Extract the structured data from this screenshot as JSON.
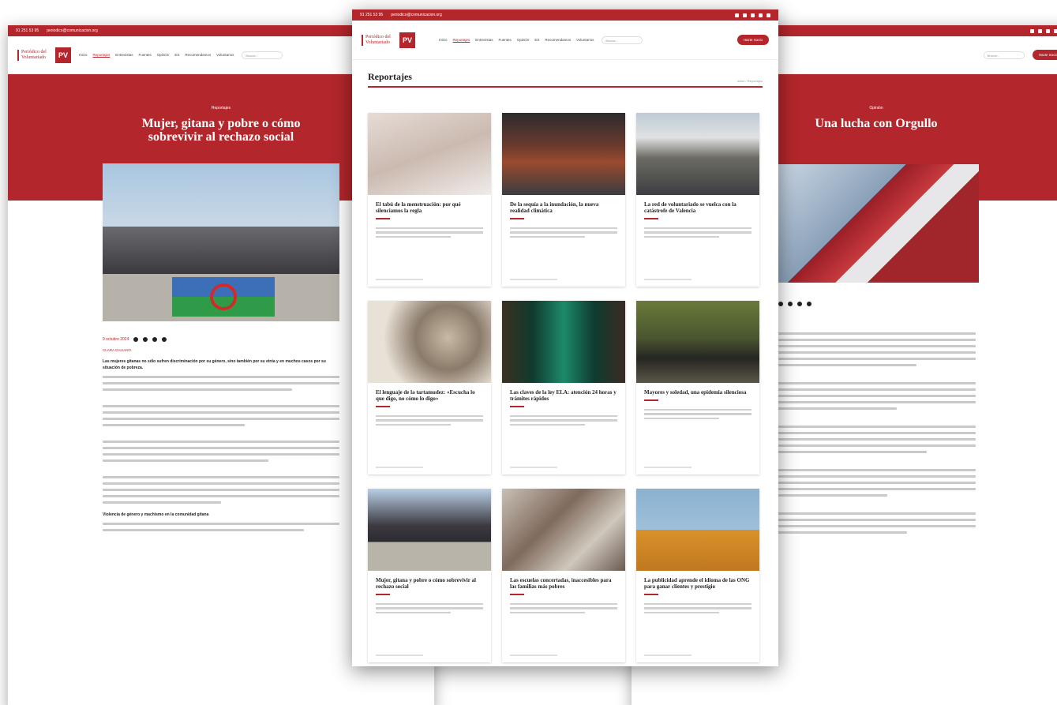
{
  "site": {
    "phone": "91 251 53 95",
    "email": "periodico@comunicacion.org",
    "logo_text": "Periódico del Voluntariado",
    "logo_badge": "PV",
    "nav": [
      "Inicio",
      "Reportajes",
      "Entrevistas",
      "Fuentes",
      "Opinión",
      "ES",
      "Recomendamos",
      "Voluntarios"
    ],
    "active_nav": "Reportajes",
    "search_placeholder": "Buscar...",
    "cta": "Hazte Socio"
  },
  "left_article": {
    "category": "Reportajes",
    "title": "Mujer, gitana y pobre o cómo sobrevivir al rechazo social",
    "date": "9 octubre 2024",
    "author": "CLARA GALIANO",
    "lead_bold": "Las mujeres gitanas no sólo sufren discriminación por su género, sino también por su etnia y en muchos casos por su situación de pobreza.",
    "subheading": "Violencia de género y machismo en la comunidad gitana"
  },
  "right_article": {
    "category": "Opinión",
    "title": "Una lucha con Orgullo"
  },
  "listing": {
    "title": "Reportajes",
    "breadcrumb": "Inicio / Reportajes",
    "cards": [
      {
        "title": "El tabú de la menstruación: por qué silenciamos la regla",
        "img": "cloth"
      },
      {
        "title": "De la sequía a la inundación, la nueva realidad climática",
        "img": "flood"
      },
      {
        "title": "La red de voluntariado se vuelca con la catástrofe de Valencia",
        "img": "street"
      },
      {
        "title": "El lenguaje de la tartamudez: «Escucha lo que digo, no cómo lo digo»",
        "img": "head"
      },
      {
        "title": "Las claves de la ley ELA: atención 24 horas y trámites rápidos",
        "img": "circuit"
      },
      {
        "title": "Mayores y soledad, una epidemia silenciosa",
        "img": "bench"
      },
      {
        "title": "Mujer, gitana y pobre o cómo sobrevivir al rechazo social",
        "img": "group"
      },
      {
        "title": "Las escuelas concertadas, inaccesibles para las familias más pobres",
        "img": "class"
      },
      {
        "title": "La publicidad aprende el idioma de las ONG para ganar clientes y prestigio",
        "img": "flag"
      }
    ]
  },
  "colors": {
    "brand": "#b3262b"
  }
}
